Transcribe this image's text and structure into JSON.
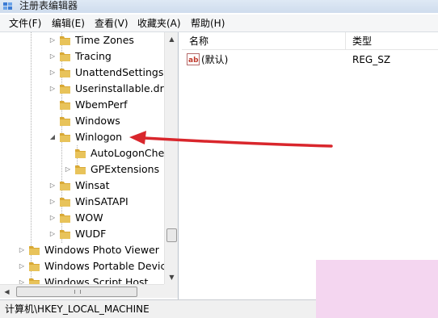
{
  "window": {
    "title": "注册表编辑器"
  },
  "menu": [
    "文件(F)",
    "编辑(E)",
    "查看(V)",
    "收藏夹(A)",
    "帮助(H)"
  ],
  "tree": {
    "items": [
      {
        "label": "Time Zones",
        "expander": "right"
      },
      {
        "label": "Tracing",
        "expander": "right"
      },
      {
        "label": "UnattendSettings",
        "expander": "right"
      },
      {
        "label": "Userinstallable.drivers",
        "expander": "right"
      },
      {
        "label": "WbemPerf",
        "expander": "none"
      },
      {
        "label": "Windows",
        "expander": "none"
      },
      {
        "label": "Winlogon",
        "expander": "down"
      },
      {
        "label": "AutoLogonChecked",
        "expander": "none"
      },
      {
        "label": "GPExtensions",
        "expander": "right"
      },
      {
        "label": "Winsat",
        "expander": "right"
      },
      {
        "label": "WinSATAPI",
        "expander": "right"
      },
      {
        "label": "WOW",
        "expander": "right"
      },
      {
        "label": "WUDF",
        "expander": "right"
      },
      {
        "label": "Windows Photo Viewer",
        "expander": "right"
      },
      {
        "label": "Windows Portable Devices",
        "expander": "right"
      },
      {
        "label": "Windows Script Host",
        "expander": "right"
      }
    ]
  },
  "list": {
    "columns": [
      "名称",
      "类型"
    ],
    "rows": [
      {
        "name": "(默认)",
        "type": "REG_SZ",
        "icon": "string-value-icon"
      }
    ]
  },
  "statusbar": {
    "path": "计算机\\HKEY_LOCAL_MACHINE"
  },
  "annotation": {
    "arrow_color": "#d9262c",
    "points_to": "Winlogon"
  },
  "colors": {
    "folder": "#e8c35a",
    "accent_arrow": "#d9262c"
  }
}
